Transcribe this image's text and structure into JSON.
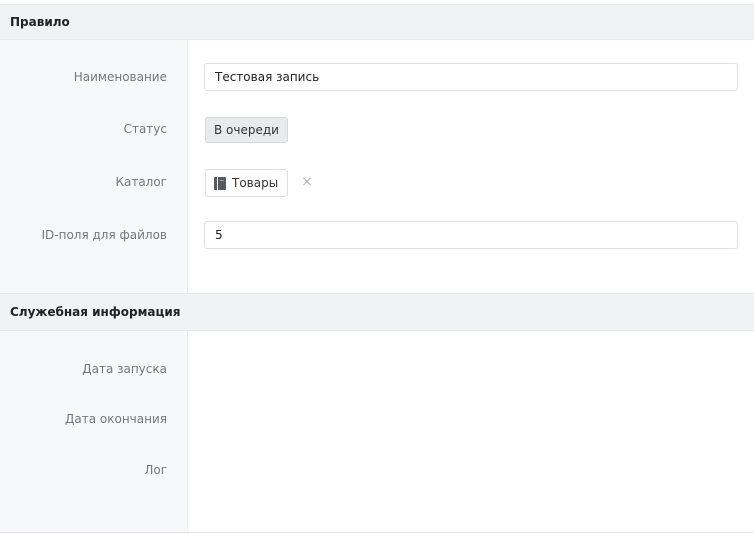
{
  "sections": {
    "rule": {
      "title": "Правило",
      "fields": {
        "name": {
          "label": "Наименование",
          "value": "Тестовая запись"
        },
        "status": {
          "label": "Статус",
          "value": "В очереди"
        },
        "catalog": {
          "label": "Каталог",
          "value": "Товары",
          "icon": "book-icon",
          "remove_icon": "close-icon"
        },
        "file_field_id": {
          "label": "ID-поля для файлов",
          "value": "5"
        }
      }
    },
    "service_info": {
      "title": "Служебная информация",
      "fields": {
        "start_date": {
          "label": "Дата запуска",
          "value": ""
        },
        "end_date": {
          "label": "Дата окончания",
          "value": ""
        },
        "log": {
          "label": "Лог",
          "value": ""
        }
      }
    }
  },
  "colors": {
    "header_bg": "#f1f2f4",
    "label_column_bg": "#f7f8f9",
    "label_text": "#777777",
    "badge_bg": "#e8eaec"
  }
}
